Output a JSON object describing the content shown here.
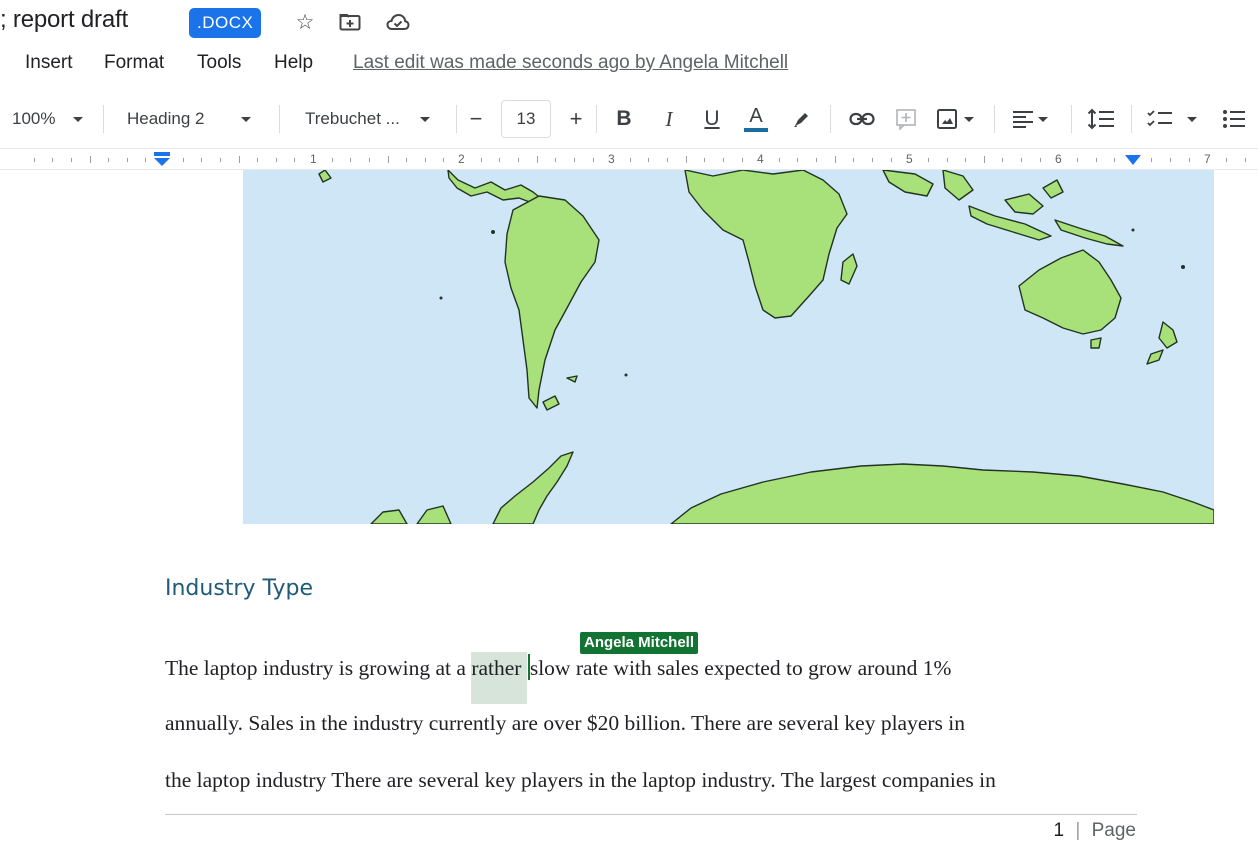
{
  "title": {
    "doc_name": "; report draft",
    "badge": ".DOCX",
    "star_icon": "star-icon",
    "move_icon": "move-to-folder-icon",
    "cloud_icon": "cloud-saved-icon"
  },
  "menu": {
    "items": [
      "Insert",
      "Format",
      "Tools",
      "Help"
    ],
    "last_edit": "Last edit was made seconds ago by Angela Mitchell"
  },
  "toolbar": {
    "zoom": "100%",
    "style": "Heading 2",
    "font": "Trebuchet ...",
    "font_size": "13",
    "decrease": "−",
    "increase": "+",
    "bold": "B",
    "italic": "I",
    "underline": "U",
    "text_color": "A"
  },
  "ruler": {
    "numbers": [
      "1",
      "2",
      "3",
      "4",
      "5",
      "6",
      "7"
    ]
  },
  "document": {
    "heading": "Industry Type",
    "line1_before": "The laptop industry is growing at a ",
    "line1_highlight": "rather ",
    "line1_after": "slow rate with sales expected to grow around 1%",
    "line2": "annually.  Sales in the industry currently are over $20 billion.  There are several key players in",
    "line3": "the laptop industry There are several key players in the laptop industry.  The largest companies in",
    "collaborator": "Angela Mitchell"
  },
  "footer": {
    "page_number": "1",
    "separator": "|",
    "page_label": "Page"
  },
  "colors": {
    "accent": "#1a73e8",
    "collaborator": "#137333",
    "heading": "#1f5a7a",
    "ocean": "#cfe6f7",
    "land": "#a8e07a"
  }
}
